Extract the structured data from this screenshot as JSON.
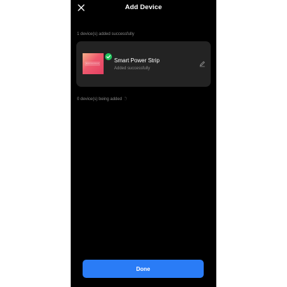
{
  "header": {
    "title": "Add Device",
    "close_icon": "close-icon"
  },
  "added_section": {
    "label": "1 device(s) added successfully",
    "devices": [
      {
        "name": "Smart Power Strip",
        "status": "Added successfully",
        "badge_icon": "check-circle-icon",
        "edit_icon": "pencil-icon"
      }
    ]
  },
  "adding_section": {
    "label": "0 device(s) being added",
    "spinner_icon": "loading-spinner-icon"
  },
  "footer": {
    "done_label": "Done"
  },
  "colors": {
    "background": "#000000",
    "card": "#232323",
    "primary": "#2a7cf6",
    "success": "#22c55e",
    "muted_text": "#8a8a8a"
  }
}
